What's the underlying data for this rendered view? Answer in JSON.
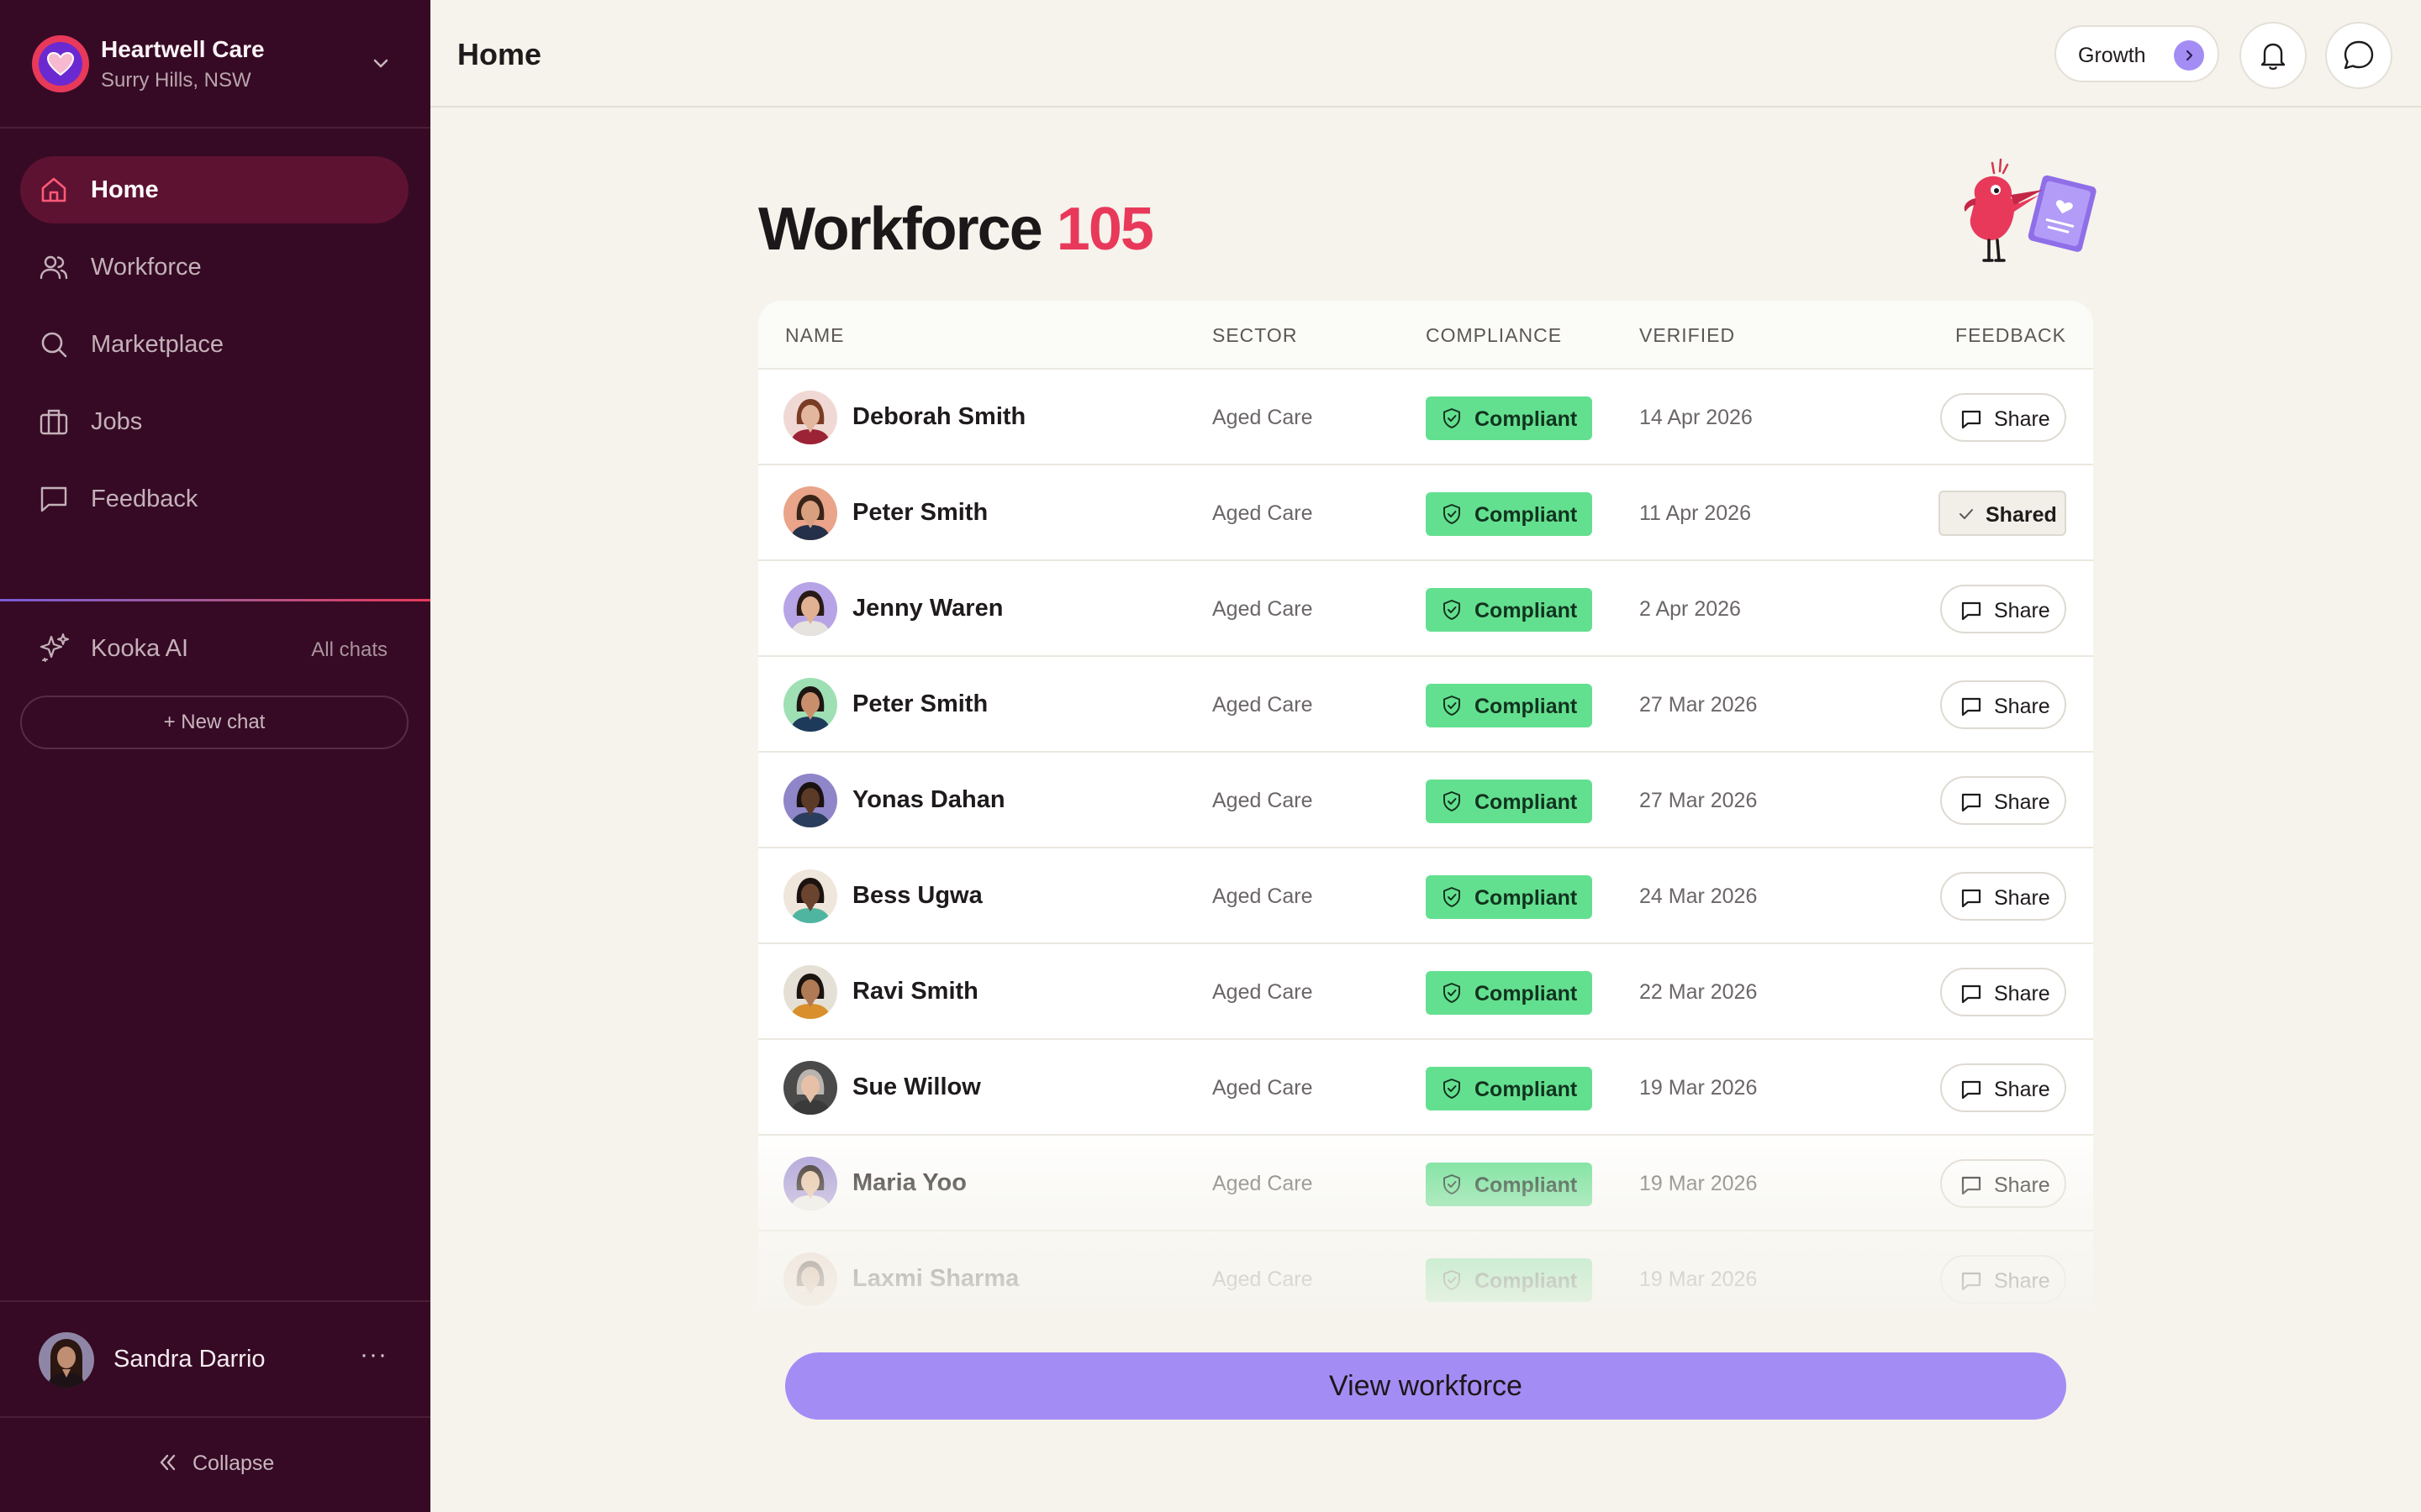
{
  "org": {
    "name": "Heartwell Care",
    "location": "Surry Hills, NSW"
  },
  "nav": [
    {
      "label": "Home",
      "icon": "home-icon",
      "active": true
    },
    {
      "label": "Workforce",
      "icon": "users-icon"
    },
    {
      "label": "Marketplace",
      "icon": "search-icon"
    },
    {
      "label": "Jobs",
      "icon": "briefcase-icon"
    },
    {
      "label": "Feedback",
      "icon": "message-square-icon"
    }
  ],
  "ai": {
    "label": "Kooka AI",
    "all_chats": "All chats",
    "new_chat": "+ New chat"
  },
  "user": {
    "name": "Sandra Darrio",
    "more": "···"
  },
  "collapse_label": "Collapse",
  "header": {
    "title": "Home",
    "plan_label": "Growth"
  },
  "hero": {
    "title": "Workforce",
    "count": "105"
  },
  "table": {
    "columns": {
      "name": "NAME",
      "sector": "SECTOR",
      "compliance": "COMPLIANCE",
      "verified": "VERIFIED",
      "feedback": "FEEDBACK"
    },
    "rows": [
      {
        "name": "Deborah Smith",
        "sector": "Aged Care",
        "compliance": "Compliant",
        "verified": "14 Apr 2026",
        "feedback": "Share"
      },
      {
        "name": "Peter Smith",
        "sector": "Aged Care",
        "compliance": "Compliant",
        "verified": "11 Apr 2026",
        "feedback": "Shared"
      },
      {
        "name": "Jenny Waren",
        "sector": "Aged Care",
        "compliance": "Compliant",
        "verified": "2 Apr 2026",
        "feedback": "Share"
      },
      {
        "name": "Peter Smith",
        "sector": "Aged Care",
        "compliance": "Compliant",
        "verified": "27 Mar 2026",
        "feedback": "Share"
      },
      {
        "name": "Yonas Dahan",
        "sector": "Aged Care",
        "compliance": "Compliant",
        "verified": "27 Mar 2026",
        "feedback": "Share"
      },
      {
        "name": "Bess Ugwa",
        "sector": "Aged Care",
        "compliance": "Compliant",
        "verified": "24 Mar 2026",
        "feedback": "Share"
      },
      {
        "name": "Ravi Smith",
        "sector": "Aged Care",
        "compliance": "Compliant",
        "verified": "22 Mar 2026",
        "feedback": "Share"
      },
      {
        "name": "Sue Willow",
        "sector": "Aged Care",
        "compliance": "Compliant",
        "verified": "19 Mar 2026",
        "feedback": "Share"
      },
      {
        "name": "Maria Yoo",
        "sector": "Aged Care",
        "compliance": "Compliant",
        "verified": "19 Mar 2026",
        "feedback": "Share"
      },
      {
        "name": "Laxmi Sharma",
        "sector": "Aged Care",
        "compliance": "Compliant",
        "verified": "19 Mar 2026",
        "feedback": "Share"
      }
    ]
  },
  "cta": {
    "label": "View workforce"
  },
  "colors": {
    "sidebar_bg": "#360a24",
    "nav_active_bg": "#5e1231",
    "accent_red": "#e8395b",
    "accent_purple": "#a48cf5",
    "compliant_green": "#63e08f",
    "page_bg": "#f5f3ec"
  }
}
